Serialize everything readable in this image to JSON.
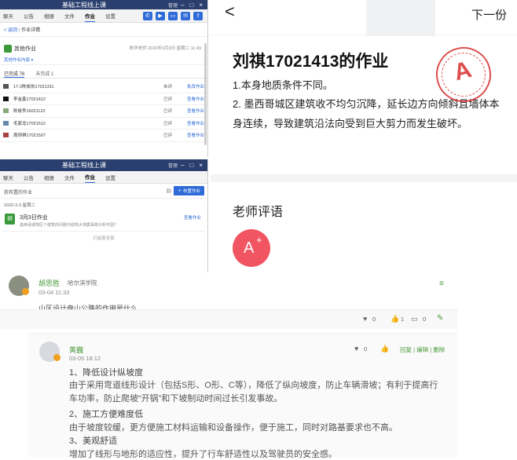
{
  "win1": {
    "title": "基础工程线上课",
    "title_caption": "管理",
    "tabs": [
      "聊天",
      "公告",
      "相册",
      "文件",
      "作业",
      "设置"
    ],
    "active_tab": "作业",
    "back_label": "< 返回",
    "breadcrumb": "作业详情",
    "hw_name": "其他作业",
    "hw_meta": "陈学老师 2020年3月3日 星期二 11:49",
    "hw_link": "其他作业内容 ▾",
    "filter_tabs": [
      "已完成 76",
      "未完成 1"
    ],
    "rows": [
      {
        "name": "17-2陈俊凯17021311",
        "status": "未评",
        "action": "批改作业"
      },
      {
        "name": "李金鑫17021412",
        "status": "已评",
        "action": "查看作业"
      },
      {
        "name": "陈俊李16021122",
        "status": "已评",
        "action": "查看作业"
      },
      {
        "name": "毛家龙17021512",
        "status": "已评",
        "action": "查看作业"
      },
      {
        "name": "周炳祺17021507",
        "status": "已评",
        "action": "查看作业"
      }
    ]
  },
  "win2": {
    "title": "基础工程线上课",
    "title_caption": "管理",
    "tabs": [
      "聊天",
      "公告",
      "相册",
      "文件",
      "作业",
      "设置"
    ],
    "active_tab": "作业",
    "subtitle": "我布置的作业",
    "publish_btn": "布置作业",
    "date": "2020-3-3 星期二",
    "hw_title": "3月3日作业",
    "hw_desc": "墨西哥城地区个建筑的问题与结构大地震事故分析可因?",
    "hw_action": "查看作业",
    "footer": "已结束全部"
  },
  "right": {
    "back_icon": "<",
    "next": "下一份",
    "title": "刘祺17021413的作业",
    "body": [
      "1.本身地质条件不同。",
      "2. 墨西哥城区建筑收不均匀沉降，延长边方向倾斜且墙体本身连续，导致建筑沿法向受到巨大剪力而发生破坏。"
    ],
    "comment_title": "老师评语",
    "grade": "A",
    "grade_sup": "+"
  },
  "forum": {
    "q_user": "胡思胜",
    "q_school": "哈尔滨学院",
    "q_time": "03-04 11:33",
    "question": "山区设计盘山公路的作用是什么",
    "q_stats": {
      "flowers": "0",
      "likes": "1",
      "comments": "0"
    },
    "a_user": "黄巍",
    "a_time": "03-05 18:12",
    "a_flowers": "0",
    "a_actions": "回复 | 编辑 | 删除",
    "answer": [
      "1、降低设计纵坡度",
      "由于采用弯道线形设计（包括S形、O形、C等），降低了纵向坡度，防止车辆滑坡；有利于提高行车功率，防止爬坡“开锅”和下坡制动时间过长引发事故。",
      "2、施工方便难度低",
      "由于坡度较缓，更方便施工材料运输和设备操作，便于施工，同时对路基要求也不高。",
      "3、美观舒适",
      "增加了线形与地形的适应性，提升了行车舒适性以及驾驶员的安全感。"
    ]
  },
  "colors": {
    "title_bar": "#2a3f6e",
    "accent": "#2f6bd8",
    "stamp": "#d93030",
    "grade_bg": "#f05561",
    "forum_green": "#4a9a3a"
  }
}
